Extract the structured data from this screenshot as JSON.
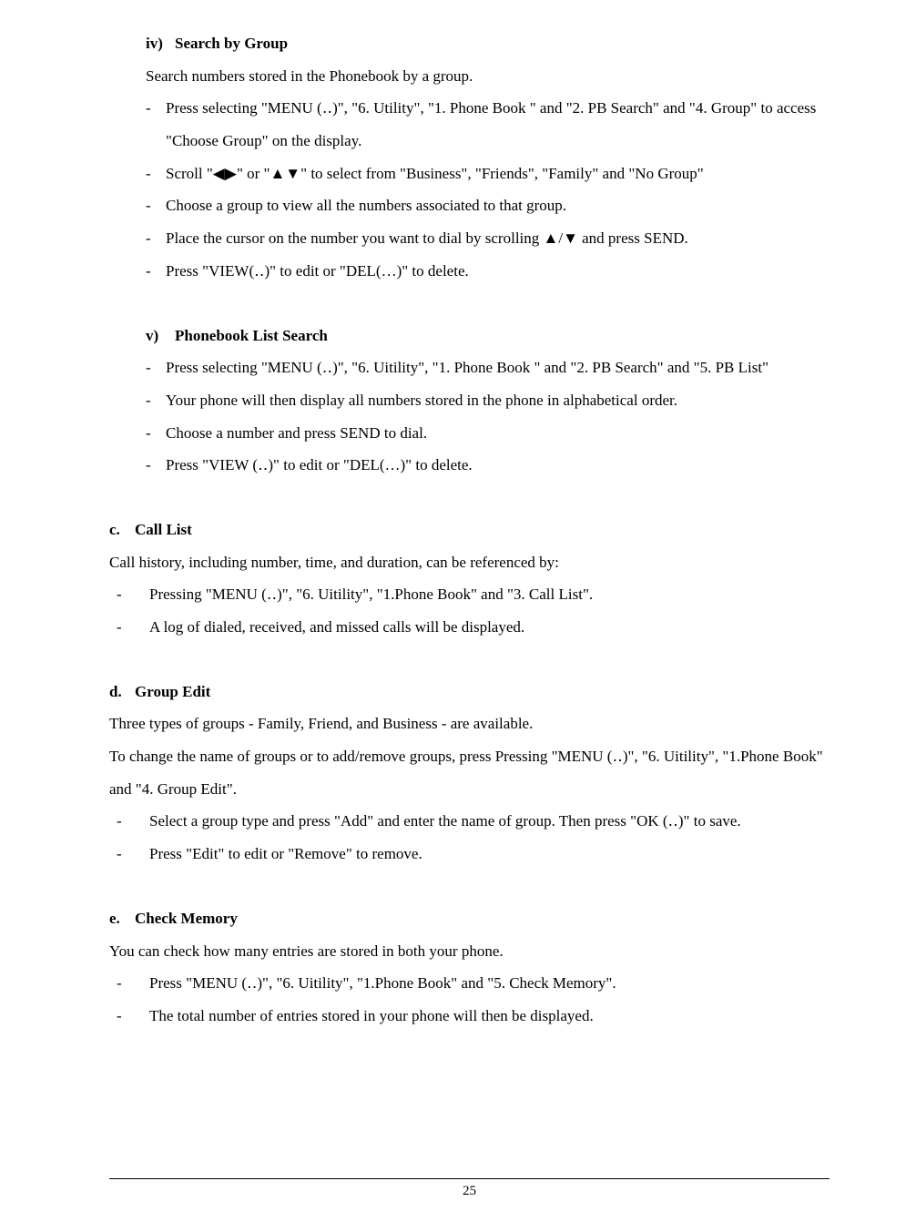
{
  "section_iv": {
    "num": "iv)",
    "title": "Search by Group",
    "intro": "Search numbers stored in the Phonebook by a group.",
    "dash": "-",
    "steps": [
      "Press selecting \"MENU (‥)\", \"6. Utility\", \"1. Phone Book \" and \"2. PB Search\" and \"4. Group\" to access \"Choose Group\" on the display.",
      "Scroll \"◀▶\" or \"▲▼\" to select from \"Business\", \"Friends\", \"Family\" and \"No Group\"",
      "Choose a group to view all the numbers associated to that group.",
      "Place the cursor on the number you want to dial by scrolling  ▲/▼  and press SEND.",
      "Press \"VIEW(‥)\" to edit or \"DEL(…)\" to delete."
    ]
  },
  "section_v": {
    "num": "v)",
    "title": "Phonebook List Search",
    "dash": "-",
    "steps": [
      "Press selecting \"MENU (‥)\", \"6. Uitility\", \"1. Phone Book \" and \"2. PB Search\" and \"5. PB List\"",
      "Your phone will then display all numbers stored in the phone in alphabetical order.",
      "Choose a number and press SEND to dial.",
      "Press \"VIEW (‥)\" to edit or \"DEL(…)\" to delete."
    ]
  },
  "section_c": {
    "letter": "c.",
    "title": "Call List",
    "intro": "Call history, including number, time, and duration, can be referenced by:",
    "dash": "-",
    "items": [
      "Pressing \"MENU (‥)\", \"6. Uitility\", \"1.Phone Book\" and \"3. Call List\".",
      "A log of dialed, received, and missed calls will be displayed."
    ]
  },
  "section_d": {
    "letter": "d.",
    "title": "Group Edit",
    "intro1": "Three types of groups - Family, Friend, and Business - are available.",
    "intro2": "To change the name of groups or to add/remove groups, press Pressing \"MENU (‥)\", \"6. Uitility\", \"1.Phone Book\" and \"4. Group Edit\".",
    "dash": "-",
    "items": [
      "Select a group type and press \"Add\" and enter the name of group.    Then press \"OK (‥)\" to save.",
      "Press \"Edit\" to edit or \"Remove\" to remove."
    ]
  },
  "section_e": {
    "letter": "e.",
    "title": "Check Memory",
    "intro": "You can check how many entries are stored in both your phone.",
    "dash": "-",
    "items": [
      "Press \"MENU (‥)\", \"6. Uitility\", \"1.Phone Book\" and \"5. Check Memory\".",
      "The total number of entries stored in your phone will then be displayed."
    ]
  },
  "page_number": "25"
}
